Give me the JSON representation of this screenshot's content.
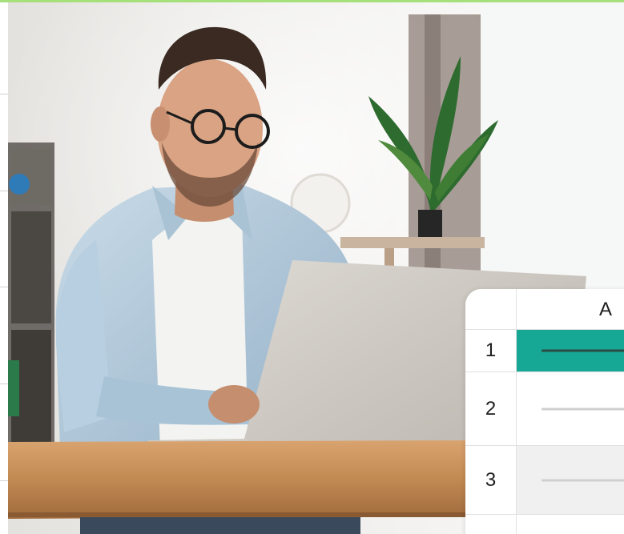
{
  "photo": {
    "subject": "man-typing-on-laptop"
  },
  "colors": {
    "accent_strip": "#a5e07a",
    "selected_cell": "#17a795",
    "selected_line": "#2d4b45",
    "cell_line": "#cfcfcf",
    "alt_row": "#f0f0f0"
  },
  "spreadsheet": {
    "columns": [
      "A"
    ],
    "rows": [
      {
        "label": "1",
        "selected": true
      },
      {
        "label": "2",
        "selected": false
      },
      {
        "label": "3",
        "selected": false
      }
    ]
  }
}
